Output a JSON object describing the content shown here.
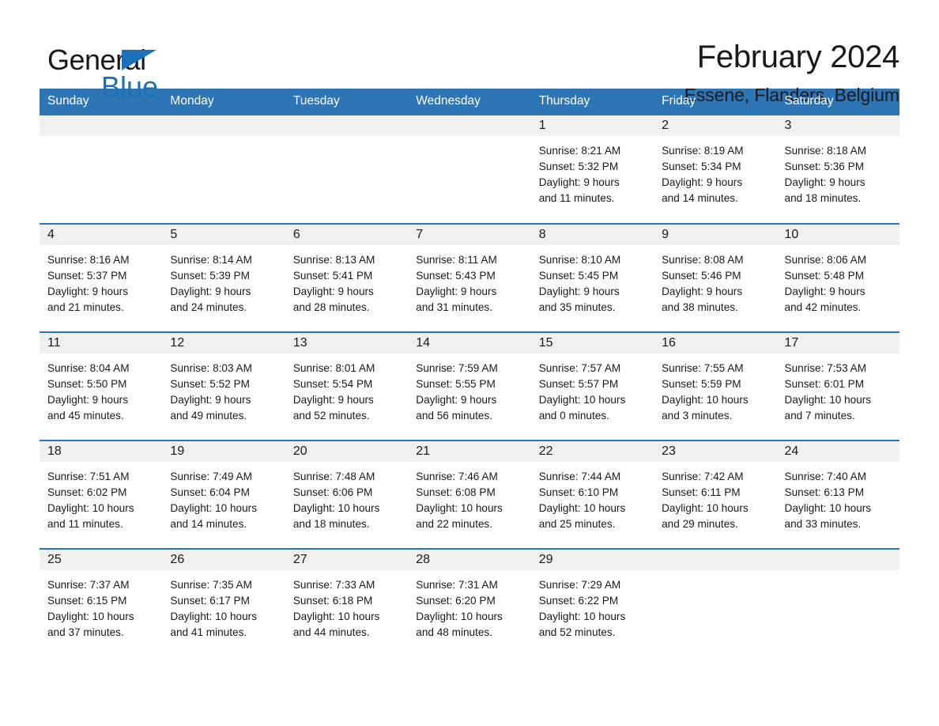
{
  "brand": {
    "name_dark": "General",
    "name_blue": "Blue",
    "logo_icon": "triangle-flag-icon",
    "accent_color": "#1b71b8"
  },
  "header": {
    "title": "February 2024",
    "location": "Essene, Flanders, Belgium"
  },
  "theme": {
    "header_bar_color": "#2e75b6",
    "daynum_band_color": "#f0f0f0",
    "text_color": "#1a1a1a"
  },
  "calendar": {
    "weekday_headers": [
      "Sunday",
      "Monday",
      "Tuesday",
      "Wednesday",
      "Thursday",
      "Friday",
      "Saturday"
    ],
    "weeks": [
      [
        {
          "day": "",
          "blank": true,
          "sunrise": "",
          "sunset": "",
          "daylight_line1": "",
          "daylight_line2": ""
        },
        {
          "day": "",
          "blank": true,
          "sunrise": "",
          "sunset": "",
          "daylight_line1": "",
          "daylight_line2": ""
        },
        {
          "day": "",
          "blank": true,
          "sunrise": "",
          "sunset": "",
          "daylight_line1": "",
          "daylight_line2": ""
        },
        {
          "day": "",
          "blank": true,
          "sunrise": "",
          "sunset": "",
          "daylight_line1": "",
          "daylight_line2": ""
        },
        {
          "day": "1",
          "blank": false,
          "sunrise": "Sunrise: 8:21 AM",
          "sunset": "Sunset: 5:32 PM",
          "daylight_line1": "Daylight: 9 hours",
          "daylight_line2": "and 11 minutes."
        },
        {
          "day": "2",
          "blank": false,
          "sunrise": "Sunrise: 8:19 AM",
          "sunset": "Sunset: 5:34 PM",
          "daylight_line1": "Daylight: 9 hours",
          "daylight_line2": "and 14 minutes."
        },
        {
          "day": "3",
          "blank": false,
          "sunrise": "Sunrise: 8:18 AM",
          "sunset": "Sunset: 5:36 PM",
          "daylight_line1": "Daylight: 9 hours",
          "daylight_line2": "and 18 minutes."
        }
      ],
      [
        {
          "day": "4",
          "blank": false,
          "sunrise": "Sunrise: 8:16 AM",
          "sunset": "Sunset: 5:37 PM",
          "daylight_line1": "Daylight: 9 hours",
          "daylight_line2": "and 21 minutes."
        },
        {
          "day": "5",
          "blank": false,
          "sunrise": "Sunrise: 8:14 AM",
          "sunset": "Sunset: 5:39 PM",
          "daylight_line1": "Daylight: 9 hours",
          "daylight_line2": "and 24 minutes."
        },
        {
          "day": "6",
          "blank": false,
          "sunrise": "Sunrise: 8:13 AM",
          "sunset": "Sunset: 5:41 PM",
          "daylight_line1": "Daylight: 9 hours",
          "daylight_line2": "and 28 minutes."
        },
        {
          "day": "7",
          "blank": false,
          "sunrise": "Sunrise: 8:11 AM",
          "sunset": "Sunset: 5:43 PM",
          "daylight_line1": "Daylight: 9 hours",
          "daylight_line2": "and 31 minutes."
        },
        {
          "day": "8",
          "blank": false,
          "sunrise": "Sunrise: 8:10 AM",
          "sunset": "Sunset: 5:45 PM",
          "daylight_line1": "Daylight: 9 hours",
          "daylight_line2": "and 35 minutes."
        },
        {
          "day": "9",
          "blank": false,
          "sunrise": "Sunrise: 8:08 AM",
          "sunset": "Sunset: 5:46 PM",
          "daylight_line1": "Daylight: 9 hours",
          "daylight_line2": "and 38 minutes."
        },
        {
          "day": "10",
          "blank": false,
          "sunrise": "Sunrise: 8:06 AM",
          "sunset": "Sunset: 5:48 PM",
          "daylight_line1": "Daylight: 9 hours",
          "daylight_line2": "and 42 minutes."
        }
      ],
      [
        {
          "day": "11",
          "blank": false,
          "sunrise": "Sunrise: 8:04 AM",
          "sunset": "Sunset: 5:50 PM",
          "daylight_line1": "Daylight: 9 hours",
          "daylight_line2": "and 45 minutes."
        },
        {
          "day": "12",
          "blank": false,
          "sunrise": "Sunrise: 8:03 AM",
          "sunset": "Sunset: 5:52 PM",
          "daylight_line1": "Daylight: 9 hours",
          "daylight_line2": "and 49 minutes."
        },
        {
          "day": "13",
          "blank": false,
          "sunrise": "Sunrise: 8:01 AM",
          "sunset": "Sunset: 5:54 PM",
          "daylight_line1": "Daylight: 9 hours",
          "daylight_line2": "and 52 minutes."
        },
        {
          "day": "14",
          "blank": false,
          "sunrise": "Sunrise: 7:59 AM",
          "sunset": "Sunset: 5:55 PM",
          "daylight_line1": "Daylight: 9 hours",
          "daylight_line2": "and 56 minutes."
        },
        {
          "day": "15",
          "blank": false,
          "sunrise": "Sunrise: 7:57 AM",
          "sunset": "Sunset: 5:57 PM",
          "daylight_line1": "Daylight: 10 hours",
          "daylight_line2": "and 0 minutes."
        },
        {
          "day": "16",
          "blank": false,
          "sunrise": "Sunrise: 7:55 AM",
          "sunset": "Sunset: 5:59 PM",
          "daylight_line1": "Daylight: 10 hours",
          "daylight_line2": "and 3 minutes."
        },
        {
          "day": "17",
          "blank": false,
          "sunrise": "Sunrise: 7:53 AM",
          "sunset": "Sunset: 6:01 PM",
          "daylight_line1": "Daylight: 10 hours",
          "daylight_line2": "and 7 minutes."
        }
      ],
      [
        {
          "day": "18",
          "blank": false,
          "sunrise": "Sunrise: 7:51 AM",
          "sunset": "Sunset: 6:02 PM",
          "daylight_line1": "Daylight: 10 hours",
          "daylight_line2": "and 11 minutes."
        },
        {
          "day": "19",
          "blank": false,
          "sunrise": "Sunrise: 7:49 AM",
          "sunset": "Sunset: 6:04 PM",
          "daylight_line1": "Daylight: 10 hours",
          "daylight_line2": "and 14 minutes."
        },
        {
          "day": "20",
          "blank": false,
          "sunrise": "Sunrise: 7:48 AM",
          "sunset": "Sunset: 6:06 PM",
          "daylight_line1": "Daylight: 10 hours",
          "daylight_line2": "and 18 minutes."
        },
        {
          "day": "21",
          "blank": false,
          "sunrise": "Sunrise: 7:46 AM",
          "sunset": "Sunset: 6:08 PM",
          "daylight_line1": "Daylight: 10 hours",
          "daylight_line2": "and 22 minutes."
        },
        {
          "day": "22",
          "blank": false,
          "sunrise": "Sunrise: 7:44 AM",
          "sunset": "Sunset: 6:10 PM",
          "daylight_line1": "Daylight: 10 hours",
          "daylight_line2": "and 25 minutes."
        },
        {
          "day": "23",
          "blank": false,
          "sunrise": "Sunrise: 7:42 AM",
          "sunset": "Sunset: 6:11 PM",
          "daylight_line1": "Daylight: 10 hours",
          "daylight_line2": "and 29 minutes."
        },
        {
          "day": "24",
          "blank": false,
          "sunrise": "Sunrise: 7:40 AM",
          "sunset": "Sunset: 6:13 PM",
          "daylight_line1": "Daylight: 10 hours",
          "daylight_line2": "and 33 minutes."
        }
      ],
      [
        {
          "day": "25",
          "blank": false,
          "sunrise": "Sunrise: 7:37 AM",
          "sunset": "Sunset: 6:15 PM",
          "daylight_line1": "Daylight: 10 hours",
          "daylight_line2": "and 37 minutes."
        },
        {
          "day": "26",
          "blank": false,
          "sunrise": "Sunrise: 7:35 AM",
          "sunset": "Sunset: 6:17 PM",
          "daylight_line1": "Daylight: 10 hours",
          "daylight_line2": "and 41 minutes."
        },
        {
          "day": "27",
          "blank": false,
          "sunrise": "Sunrise: 7:33 AM",
          "sunset": "Sunset: 6:18 PM",
          "daylight_line1": "Daylight: 10 hours",
          "daylight_line2": "and 44 minutes."
        },
        {
          "day": "28",
          "blank": false,
          "sunrise": "Sunrise: 7:31 AM",
          "sunset": "Sunset: 6:20 PM",
          "daylight_line1": "Daylight: 10 hours",
          "daylight_line2": "and 48 minutes."
        },
        {
          "day": "29",
          "blank": false,
          "sunrise": "Sunrise: 7:29 AM",
          "sunset": "Sunset: 6:22 PM",
          "daylight_line1": "Daylight: 10 hours",
          "daylight_line2": "and 52 minutes."
        },
        {
          "day": "",
          "blank": true,
          "sunrise": "",
          "sunset": "",
          "daylight_line1": "",
          "daylight_line2": ""
        },
        {
          "day": "",
          "blank": true,
          "sunrise": "",
          "sunset": "",
          "daylight_line1": "",
          "daylight_line2": ""
        }
      ]
    ]
  }
}
